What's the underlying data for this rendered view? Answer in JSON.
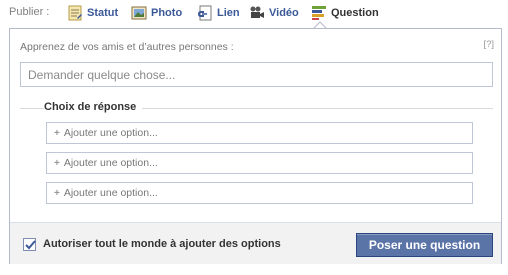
{
  "publish": {
    "label": "Publier :",
    "tabs": [
      {
        "label": "Statut",
        "icon": "status-icon"
      },
      {
        "label": "Photo",
        "icon": "photo-icon"
      },
      {
        "label": "Lien",
        "icon": "link-icon"
      },
      {
        "label": "Vidéo",
        "icon": "video-icon"
      },
      {
        "label": "Question",
        "icon": "question-icon",
        "active": true
      }
    ]
  },
  "composer": {
    "hint": "Apprenez de vos amis et d’autres personnes :",
    "help": "[?]",
    "question_placeholder": "Demander quelque chose...",
    "choices_title": "Choix de réponse",
    "options": [
      {
        "placeholder": "Ajouter une option..."
      },
      {
        "placeholder": "Ajouter une option..."
      },
      {
        "placeholder": "Ajouter une option..."
      }
    ],
    "allow_all_label": "Autoriser tout le monde à ajouter des options",
    "allow_all_checked": true,
    "submit_label": "Poser une question"
  },
  "colors": {
    "link": "#3b5998",
    "button_bg": "#5b74a8",
    "border": "#b4bbcd"
  }
}
